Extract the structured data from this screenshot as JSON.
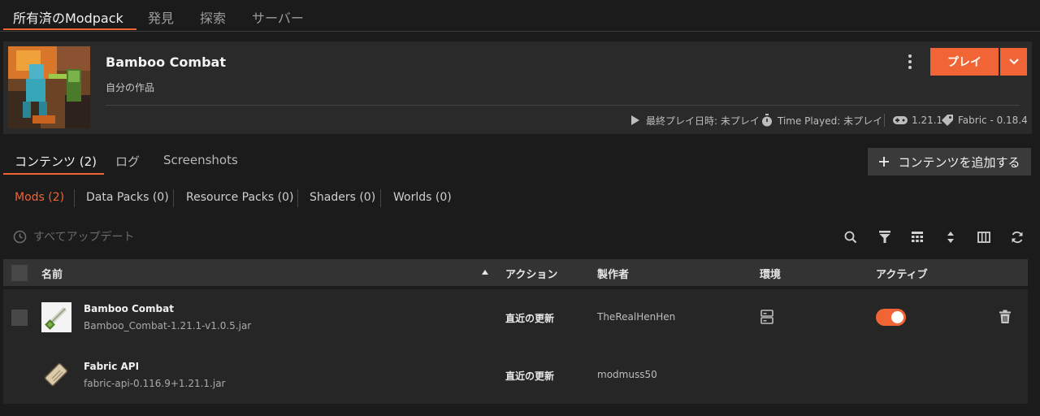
{
  "top_tabs": [
    "所有済のModpack",
    "発見",
    "探索",
    "サーバー"
  ],
  "header": {
    "title": "Bamboo Combat",
    "subtitle": "自分の作品",
    "play_label": "プレイ",
    "last_played": "最終プレイ日時: 未プレイ",
    "time_played": "Time Played: 未プレイ",
    "mc_version": "1.21.1",
    "loader": "Fabric - 0.18.4"
  },
  "content_tabs": [
    "コンテンツ (2)",
    "ログ",
    "Screenshots"
  ],
  "add_content_label": "コンテンツを追加する",
  "filters": [
    "Mods (2)",
    "Data Packs (0)",
    "Resource Packs (0)",
    "Shaders (0)",
    "Worlds (0)"
  ],
  "update_all_label": "すべてアップデート",
  "table": {
    "headers": [
      "名前",
      "アクション",
      "製作者",
      "環境",
      "アクティブ"
    ],
    "rows": [
      {
        "name": "Bamboo Combat",
        "file": "Bamboo_Combat-1.21.1-v1.0.5.jar",
        "action": "直近の更新",
        "author": "TheRealHenHen",
        "active": true
      },
      {
        "name": "Fabric API",
        "file": "fabric-api-0.116.9+1.21.1.jar",
        "action": "直近の更新",
        "author": "modmuss50"
      }
    ]
  },
  "colors": {
    "accent": "#f16436",
    "background": "#1b1b1b",
    "card": "#2a2a2a"
  },
  "icons": [
    "play-triangle-icon",
    "stopwatch-icon",
    "gamepad-icon",
    "tag-icon",
    "chevron-down-icon",
    "kebab-icon",
    "plus-icon",
    "clock-icon",
    "search-icon",
    "filter-icon",
    "grid-icon",
    "sort-icon",
    "columns-icon",
    "refresh-icon",
    "server-icon",
    "trash-icon",
    "sort-asc-icon"
  ]
}
